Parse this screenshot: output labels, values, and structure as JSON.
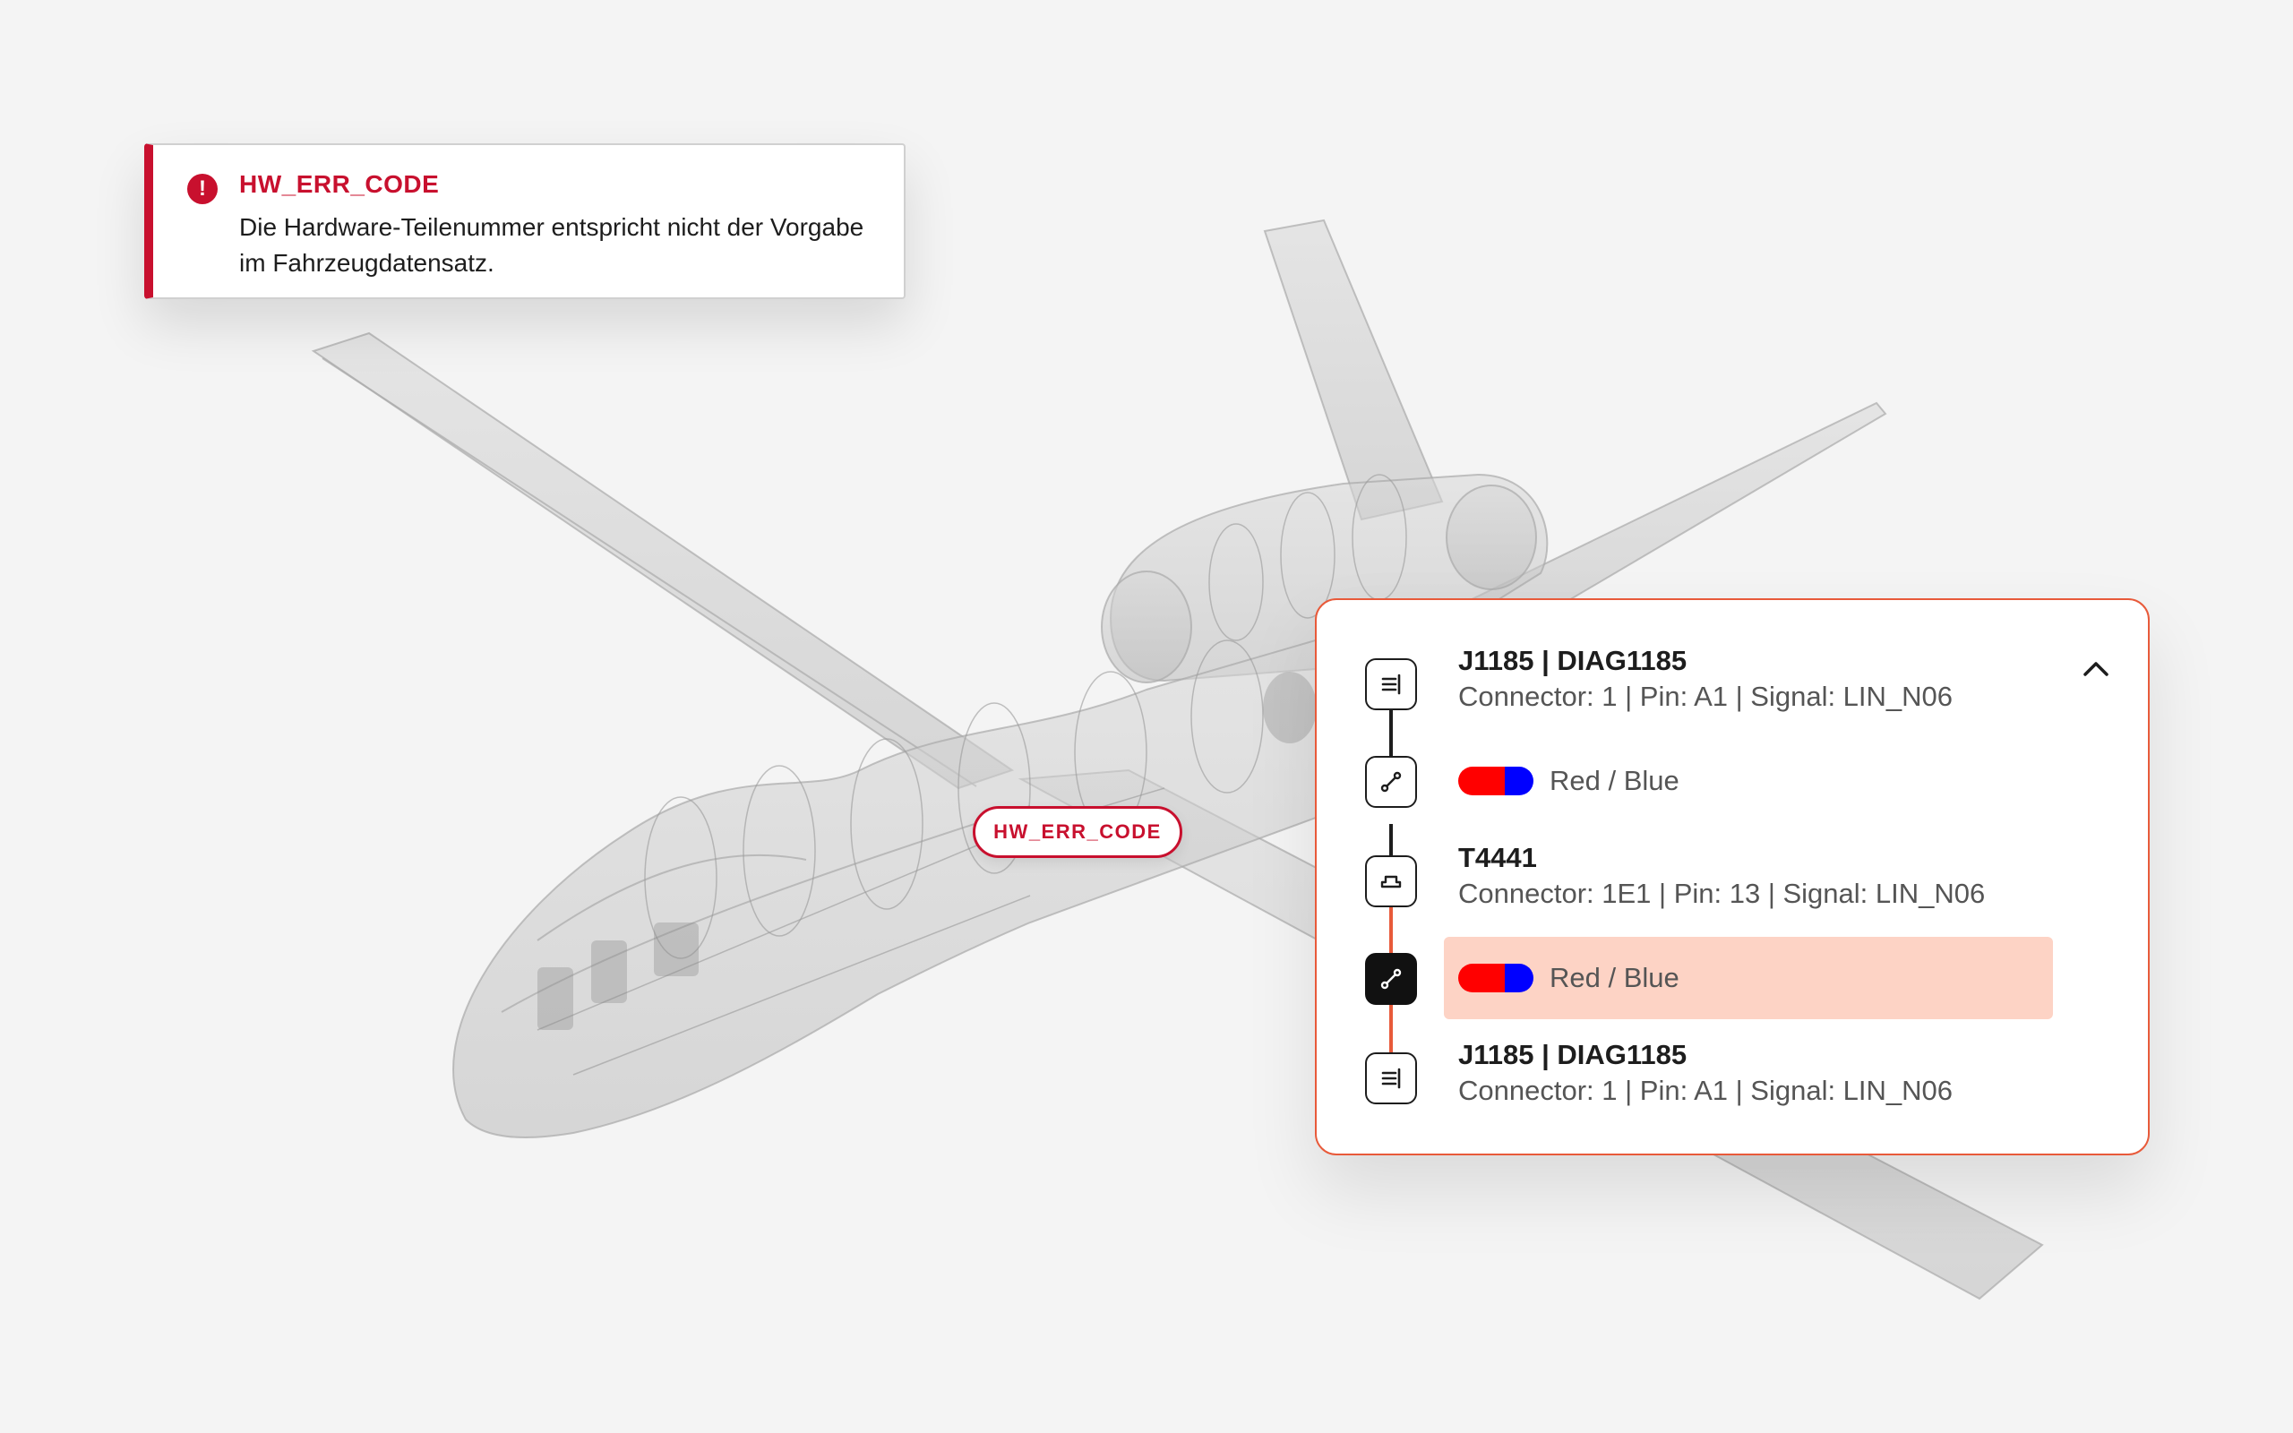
{
  "error": {
    "code": "HW_ERR_CODE",
    "message": "Die Hardware-Teilenummer entspricht nicht der Vorgabe im Fahrzeugdatensatz.",
    "icon": "error-icon",
    "color": "#c8102e"
  },
  "marker": {
    "label": "HW_ERR_CODE"
  },
  "panel": {
    "accent_color": "#e85a3a",
    "highlight_color": "#fdd3c5",
    "collapse_icon": "chevron-up-icon",
    "items": [
      {
        "type": "connector",
        "icon": "connector-icon",
        "title": "J1185 | DIAG1185",
        "detail": "Connector: 1 | Pin: A1 | Signal: LIN_N06"
      },
      {
        "type": "wire",
        "icon": "wire-icon",
        "label": "Red / Blue",
        "colors": [
          "#ff0000",
          "#0000ff"
        ]
      },
      {
        "type": "connector",
        "icon": "splice-icon",
        "title": "T4441",
        "detail": "Connector: 1E1 | Pin: 13 | Signal: LIN_N06"
      },
      {
        "type": "wire",
        "icon": "wire-icon",
        "label": "Red / Blue",
        "colors": [
          "#ff0000",
          "#0000ff"
        ],
        "selected": true
      },
      {
        "type": "connector",
        "icon": "connector-icon",
        "title": "J1185 | DIAG1185",
        "detail": "Connector: 1 | Pin: A1 | Signal: LIN_N06"
      }
    ]
  }
}
